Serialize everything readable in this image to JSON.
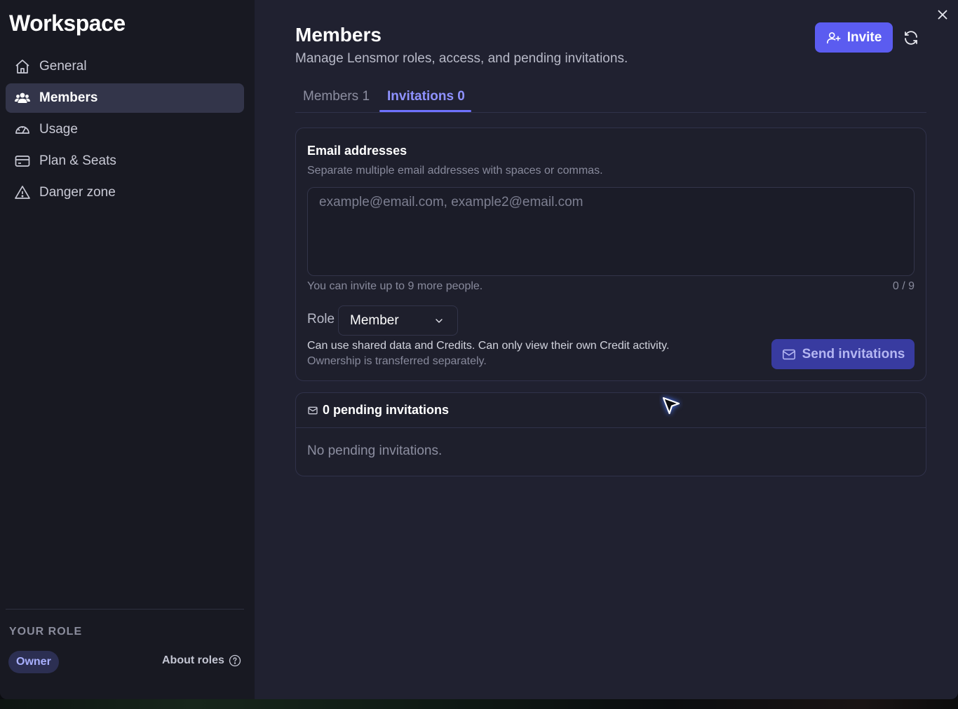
{
  "sidebar": {
    "title": "Workspace",
    "items": [
      {
        "label": "General",
        "icon": "home-icon"
      },
      {
        "label": "Members",
        "icon": "users-icon",
        "active": true
      },
      {
        "label": "Usage",
        "icon": "gauge-icon"
      },
      {
        "label": "Plan & Seats",
        "icon": "credit-card-icon"
      },
      {
        "label": "Danger zone",
        "icon": "warning-icon"
      }
    ],
    "role_heading": "YOUR ROLE",
    "role_badge": "Owner",
    "about_roles": "About roles"
  },
  "header": {
    "title": "Members",
    "subtitle": "Manage Lensmor roles, access, and pending invitations.",
    "invite_label": "Invite"
  },
  "tabs": [
    {
      "label": "Members 1",
      "active": false
    },
    {
      "label": "Invitations 0",
      "active": true
    }
  ],
  "invite_form": {
    "email_label": "Email addresses",
    "email_hint": "Separate multiple email addresses with spaces or commas.",
    "email_value": "",
    "email_placeholder": "example@email.com, example2@email.com",
    "limit_text": "You can invite up to 9 more people.",
    "count_text": "0 / 9",
    "role_label": "Role",
    "role_value": "Member",
    "role_description": "Can use shared data and Credits. Can only view their own Credit activity.",
    "role_note": "Ownership is transferred separately.",
    "send_label": "Send invitations"
  },
  "pending": {
    "title": "0 pending invitations",
    "empty_text": "No pending invitations."
  },
  "colors": {
    "accent": "#5b5cf0",
    "accent_text": "#8f92ff",
    "background": "#202130",
    "sidebar": "#181922"
  }
}
